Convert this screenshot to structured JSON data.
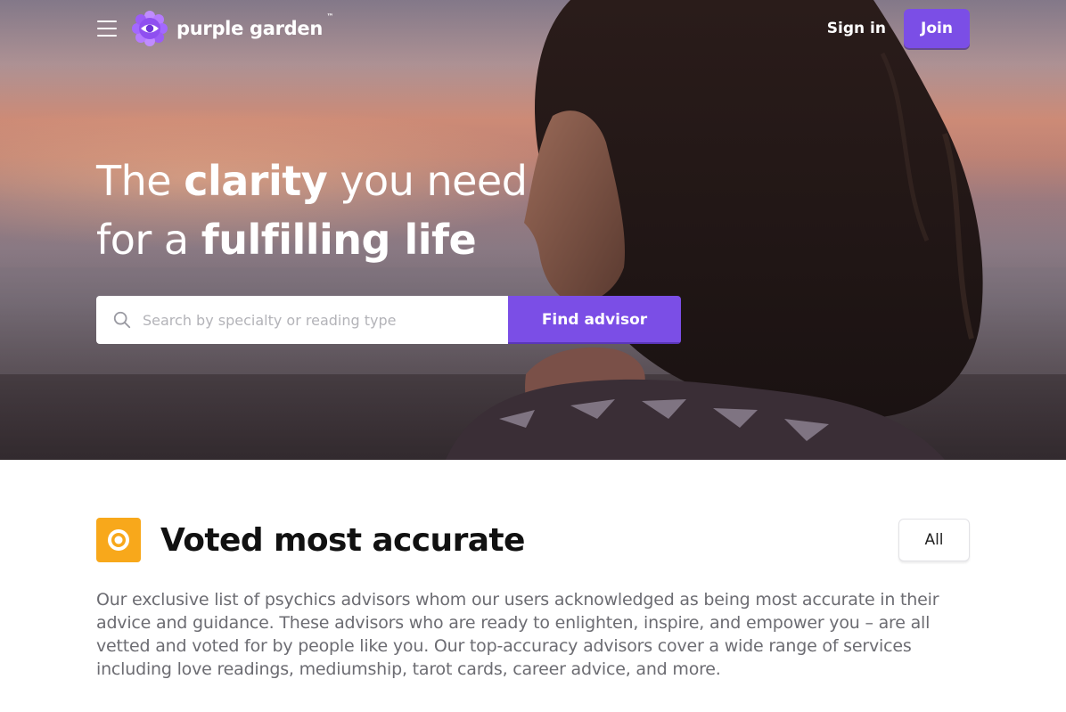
{
  "brand": {
    "name": "purple garden",
    "trademark": "™",
    "accent": "#7b4ee6"
  },
  "nav": {
    "signin_label": "Sign in",
    "join_label": "Join"
  },
  "hero": {
    "headline_line1_a": "The ",
    "headline_line1_bold": "clarity",
    "headline_line1_b": " you need",
    "headline_line2_a": "for a ",
    "headline_line2_bold": "fulfilling life"
  },
  "search": {
    "placeholder": "Search by specialty or reading type",
    "value": "",
    "button_label": "Find advisor"
  },
  "section": {
    "title": "Voted most accurate",
    "icon": "target-icon",
    "icon_color": "#f8a81b",
    "filter_label": "All",
    "description": "Our exclusive list of psychics advisors whom our users acknowledged as being most accurate in their advice and guidance. These advisors who are ready to enlighten, inspire, and empower you – are all vetted and voted for by people like you. Our top-accuracy advisors cover a wide range of services including love readings, mediumship, tarot cards, career advice, and more."
  }
}
